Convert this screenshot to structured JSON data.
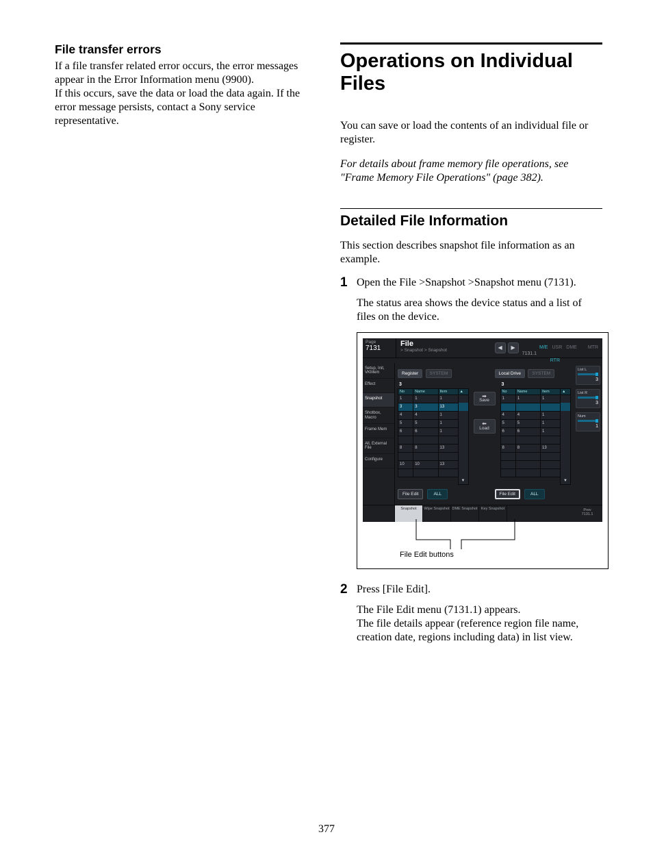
{
  "left": {
    "heading": "File transfer errors",
    "p1": "If a file transfer related error occurs, the error messages appear in the Error Information menu (9900).",
    "p2": "If this occurs, save the data or load the data again. If the error message persists, contact a Sony service representative."
  },
  "right": {
    "title": "Operations on Individual Files",
    "intro": "You can save or load the contents of an individual file or register.",
    "note": "For details about frame memory file operations, see \"Frame Memory File Operations\" (page 382).",
    "section": "Detailed File Information",
    "section_p": "This section describes snapshot file information as an example.",
    "step1_num": "1",
    "step1": "Open the File >Snapshot >Snapshot menu (7131).",
    "step1_sub": "The status area shows the device status and a list of files on the device.",
    "step2_num": "2",
    "step2": "Press [File Edit].",
    "step2_sub": "The File Edit menu (7131.1) appears.\nThe file details appear (reference region file name, creation date, regions including data) in list view."
  },
  "fig": {
    "annot": "File Edit buttons",
    "page_label": "Page",
    "page_num": "7131",
    "title": "File",
    "crumb": "> Snapshot > Snapshot",
    "navnum": "7131.1",
    "toptabs": {
      "me": "M/E",
      "rtr": "RTR",
      "usr": "USR",
      "dme": "DME",
      "mtr": "MTR"
    },
    "side": [
      "Setup, Init,\nVKMem",
      "Effect",
      "Snapshot",
      "Shotbox,\nMacro",
      "Frame Mem",
      "All,\nExternal File",
      "Configure"
    ],
    "left_btns": {
      "register": "Register",
      "system": "SYSTEM"
    },
    "right_btns": {
      "local": "Local Drive",
      "system": "SYSTEM"
    },
    "left_panel": {
      "count": "3",
      "headers": [
        "No",
        "Name",
        "Item"
      ],
      "rows": [
        {
          "no": "1",
          "name": "1",
          "item": "1"
        },
        {
          "no": "3",
          "name": "3",
          "item": "13",
          "sel": true
        },
        {
          "no": "4",
          "name": "4",
          "item": "1"
        },
        {
          "no": "5",
          "name": "5",
          "item": "1"
        },
        {
          "no": "6",
          "name": "6",
          "item": "1"
        },
        {
          "no": "",
          "name": "",
          "item": ""
        },
        {
          "no": "8",
          "name": "8",
          "item": "13"
        },
        {
          "no": "",
          "name": "",
          "item": ""
        },
        {
          "no": "10",
          "name": "10",
          "item": "13"
        },
        {
          "no": "",
          "name": "",
          "item": ""
        }
      ]
    },
    "right_panel": {
      "count": "3",
      "headers": [
        "No",
        "Name",
        "Item"
      ],
      "rows": [
        {
          "no": "1",
          "name": "1",
          "item": "1"
        },
        {
          "no": "",
          "name": "",
          "item": "",
          "sel": true
        },
        {
          "no": "4",
          "name": "4",
          "item": "1"
        },
        {
          "no": "5",
          "name": "5",
          "item": "1"
        },
        {
          "no": "6",
          "name": "6",
          "item": "1"
        },
        {
          "no": "",
          "name": "",
          "item": ""
        },
        {
          "no": "8",
          "name": "8",
          "item": "13"
        },
        {
          "no": "",
          "name": "",
          "item": ""
        },
        {
          "no": "",
          "name": "",
          "item": ""
        },
        {
          "no": "",
          "name": "",
          "item": ""
        }
      ]
    },
    "ctrl": {
      "save": "Save",
      "load": "Load"
    },
    "bottom": {
      "file_edit": "File Edit",
      "all": "ALL"
    },
    "tabs": [
      "Snapshot",
      "Wipe\nSnapshot",
      "DME\nSnapshot",
      "Key\nSnapshot"
    ],
    "prev": {
      "label": "Prev",
      "num": "7131.1"
    },
    "right_col": {
      "listL": {
        "label": "List L",
        "val": "3"
      },
      "listR": {
        "label": "List R",
        "val": "3"
      },
      "num": {
        "label": "Num",
        "val": "1"
      }
    }
  },
  "pagenum": "377"
}
